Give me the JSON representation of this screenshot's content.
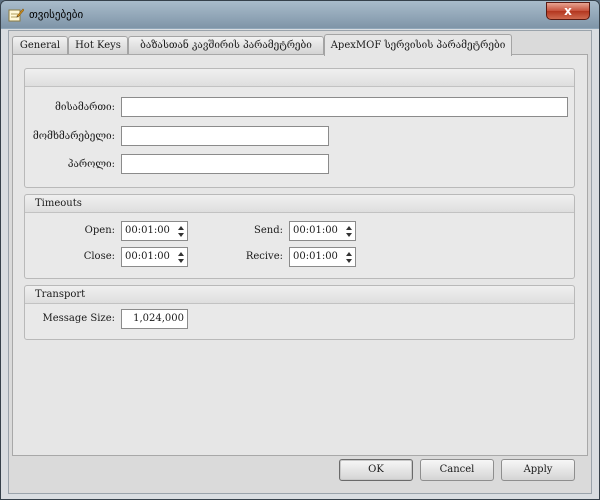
{
  "window": {
    "title": "თვისებები",
    "close_glyph": "x"
  },
  "tabs": [
    {
      "label": "General"
    },
    {
      "label": "Hot Keys"
    },
    {
      "label": "ბაზასთან კავშირის პარამეტრები"
    },
    {
      "label": "ApexMOF სერვისის პარამეტრები"
    }
  ],
  "connection": {
    "group_title": "",
    "address_label": "მისამართი:",
    "address_value": "",
    "user_label": "მომხმარებელი:",
    "user_value": "",
    "password_label": "პაროლი:",
    "password_value": ""
  },
  "timeouts": {
    "title": "Timeouts",
    "open_label": "Open:",
    "open_value": "00:01:00",
    "close_label": "Close:",
    "close_value": "00:01:00",
    "send_label": "Send:",
    "send_value": "00:01:00",
    "recive_label": "Recive:",
    "recive_value": "00:01:00"
  },
  "transport": {
    "title": "Transport",
    "message_size_label": "Message Size:",
    "message_size_value": "1,024,000"
  },
  "buttons": {
    "ok": "OK",
    "cancel": "Cancel",
    "apply": "Apply"
  }
}
